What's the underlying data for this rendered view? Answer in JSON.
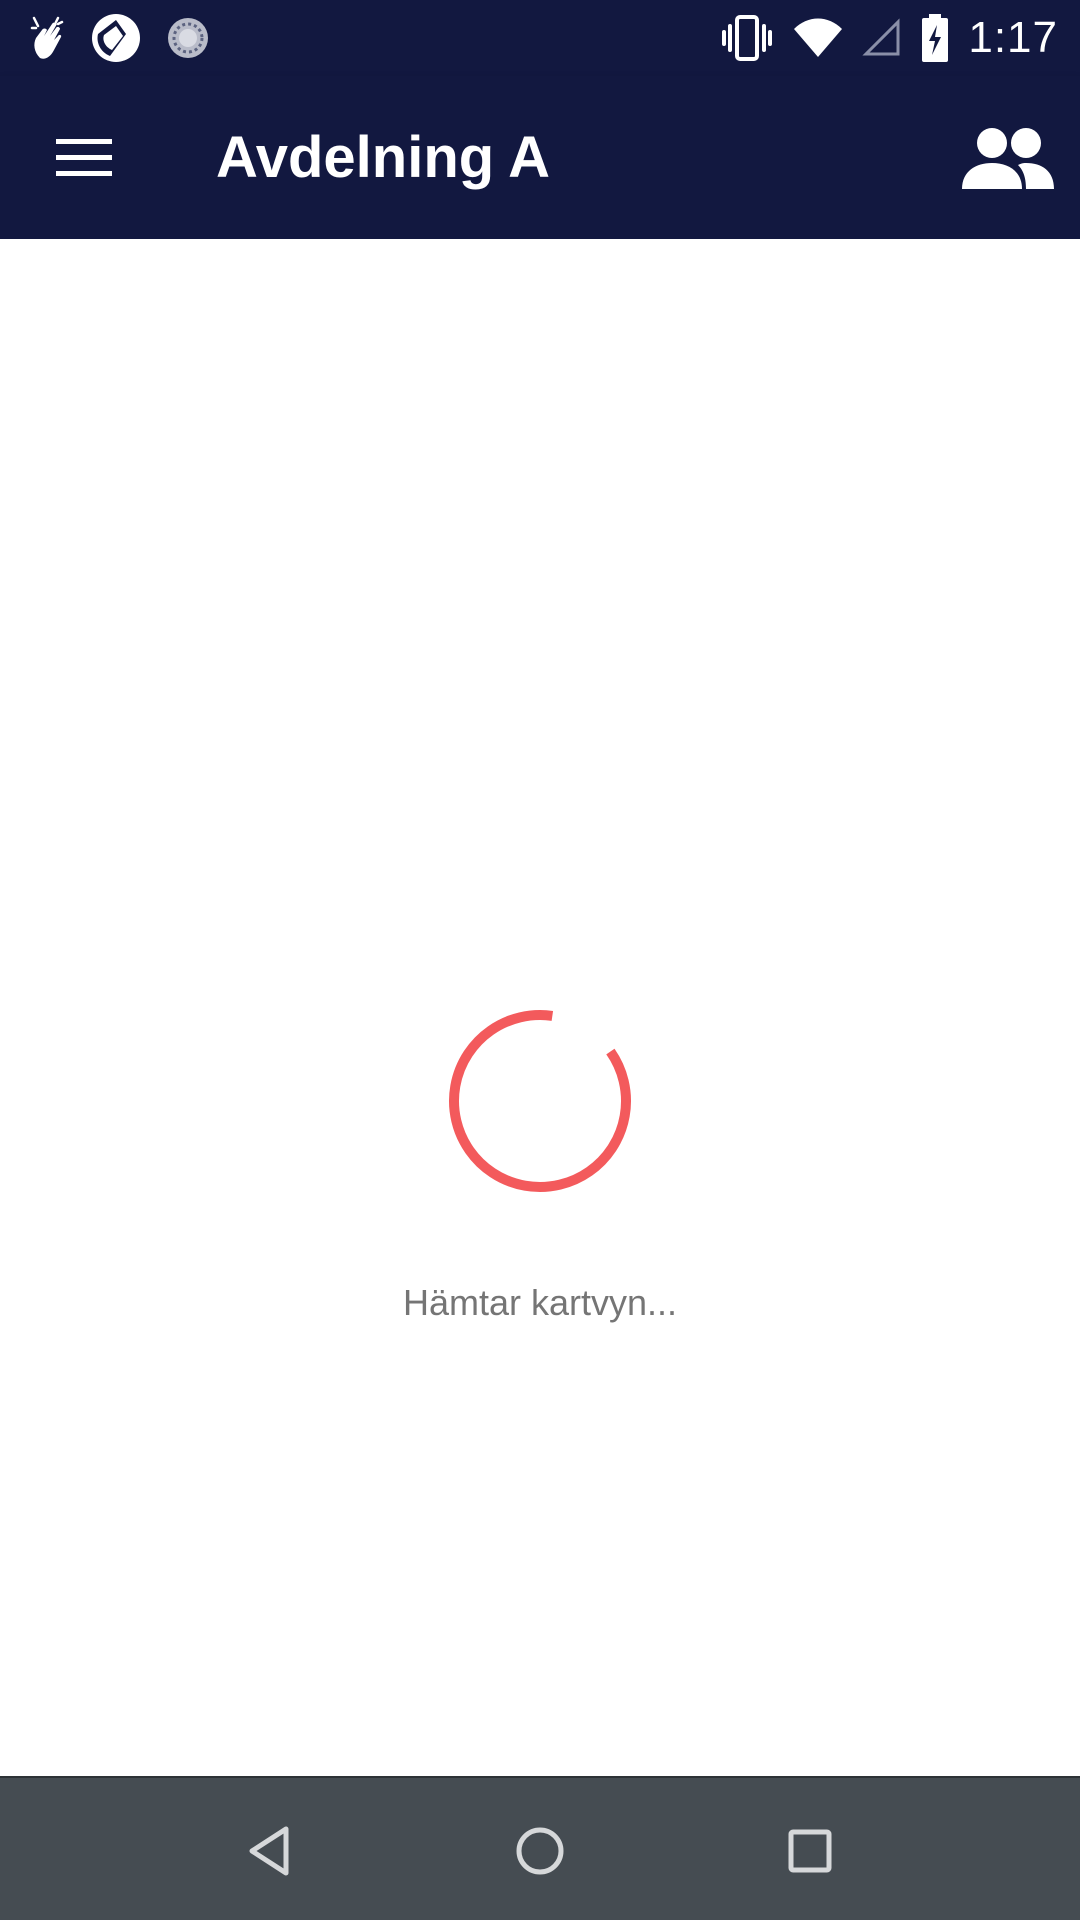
{
  "status_bar": {
    "time": "1:17",
    "left_icons": [
      "hand-wave-icon",
      "camera-shutter-icon",
      "sync-circle-icon"
    ],
    "right_icons": [
      "vibrate-icon",
      "wifi-icon",
      "cell-signal-icon",
      "battery-charging-icon"
    ]
  },
  "app_bar": {
    "title": "Avdelning A",
    "menu_icon": "hamburger-menu-icon",
    "action_icon": "people-icon",
    "background_color": "#121840"
  },
  "content": {
    "loading_text": "Hämtar kartvyn...",
    "spinner_color": "#f35a5c"
  },
  "nav_bar": {
    "buttons": [
      "back-icon",
      "home-icon",
      "recents-icon"
    ],
    "background_color": "#454c52"
  }
}
